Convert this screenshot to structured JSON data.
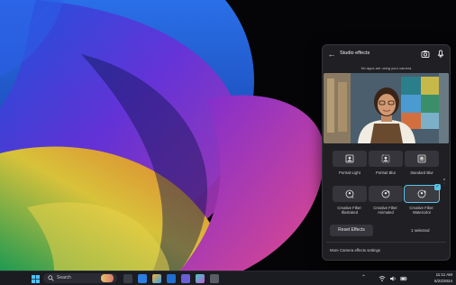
{
  "panel": {
    "back_icon": "arrow-left-icon",
    "title": "Studio effects",
    "header_icons": [
      "camera-icon",
      "microphone-icon"
    ],
    "notice": "No apps are using your camera",
    "effects_row1": [
      {
        "label": "Portrait Light",
        "icon": "portrait-light-icon",
        "selected": false
      },
      {
        "label": "Portrait Blur",
        "icon": "portrait-blur-icon",
        "selected": false
      },
      {
        "label": "Standard Blur",
        "icon": "standard-blur-icon",
        "selected": false
      }
    ],
    "effects_row2": [
      {
        "label_line1": "Creative Filter:",
        "label_line2": "Illustrated",
        "icon": "filter-illustrated-icon",
        "selected": false
      },
      {
        "label_line1": "Creative Filter:",
        "label_line2": "Animated",
        "icon": "filter-animated-icon",
        "selected": false
      },
      {
        "label_line1": "Creative Filter:",
        "label_line2": "Watercolor",
        "icon": "filter-watercolor-icon",
        "selected": true
      }
    ],
    "reset_label": "Reset Effects",
    "selected_count": "1 selected",
    "more_settings": "More Camera effects settings"
  },
  "taskbar": {
    "search_placeholder": "Search",
    "pinned_apps": [
      "file-explorer-icon",
      "edge-icon",
      "store-icon",
      "mail-icon",
      "teams-icon",
      "copilot-icon",
      "settings-icon"
    ],
    "tray_icons": [
      "wifi-icon",
      "volume-icon",
      "battery-icon"
    ],
    "time": "11:11 AM",
    "date": "5/22/2024"
  },
  "colors": {
    "accent": "#5cc4e8",
    "panel_bg": "#202024",
    "taskbar_bg": "#1b1c22"
  }
}
